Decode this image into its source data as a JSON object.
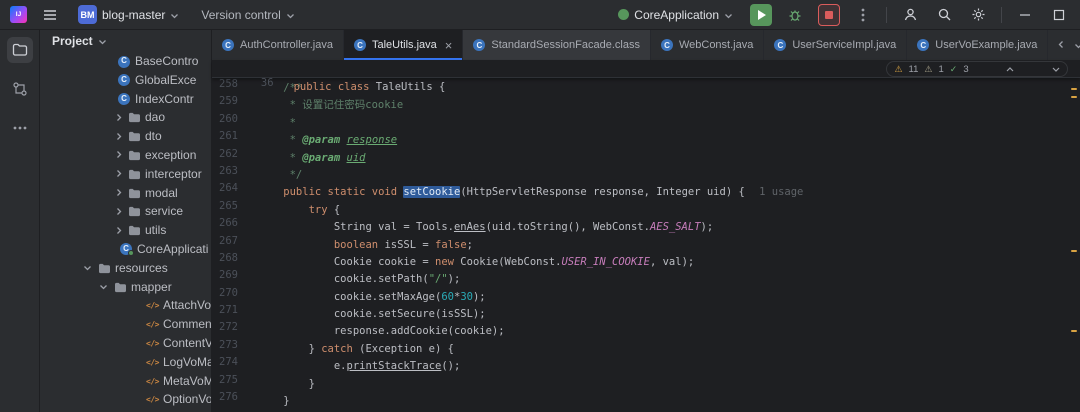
{
  "icons": {
    "logo_text": "IJ",
    "class_glyph": "C",
    "xml_glyph": "</>",
    "close_glyph": "×",
    "more_glyph": "⋯",
    "warn_glyph": "⚠",
    "ok_glyph": "✓"
  },
  "titlebar": {
    "project_badge": "BM",
    "project_name": "blog-master",
    "vcs_label": "Version control",
    "run_config_name": "CoreApplication"
  },
  "project_panel": {
    "title": "Project",
    "tree": [
      {
        "label": "BaseContro",
        "kind": "class",
        "iconX": 78
      },
      {
        "label": "GlobalExce",
        "kind": "class",
        "iconX": 78
      },
      {
        "label": "IndexContr",
        "kind": "class",
        "iconX": 78
      },
      {
        "label": "dao",
        "kind": "folder",
        "chev": "right",
        "chevX": 74,
        "iconX": 88
      },
      {
        "label": "dto",
        "kind": "folder",
        "chev": "right",
        "chevX": 74,
        "iconX": 88
      },
      {
        "label": "exception",
        "kind": "folder",
        "chev": "right",
        "chevX": 74,
        "iconX": 88
      },
      {
        "label": "interceptor",
        "kind": "folder",
        "chev": "right",
        "chevX": 74,
        "iconX": 88
      },
      {
        "label": "modal",
        "kind": "folder",
        "chev": "right",
        "chevX": 74,
        "iconX": 88
      },
      {
        "label": "service",
        "kind": "folder",
        "chev": "right",
        "chevX": 74,
        "iconX": 88
      },
      {
        "label": "utils",
        "kind": "folder",
        "chev": "right",
        "chevX": 74,
        "iconX": 88
      },
      {
        "label": "CoreApplicati",
        "kind": "boot",
        "iconX": 80
      },
      {
        "label": "resources",
        "kind": "folder",
        "chev": "down",
        "chevX": 42,
        "iconX": 58
      },
      {
        "label": "mapper",
        "kind": "folder",
        "chev": "down",
        "chevX": 58,
        "iconX": 74
      },
      {
        "label": "AttachVoMap",
        "kind": "xml",
        "iconX": 106
      },
      {
        "label": "CommentVoM",
        "kind": "xml",
        "iconX": 106
      },
      {
        "label": "ContentVoMa",
        "kind": "xml",
        "iconX": 106
      },
      {
        "label": "LogVoMappe",
        "kind": "xml",
        "iconX": 106
      },
      {
        "label": "MetaVoMapp",
        "kind": "xml",
        "iconX": 106
      },
      {
        "label": "OptionVoMap",
        "kind": "xml",
        "iconX": 106
      }
    ]
  },
  "tabs": {
    "items": [
      {
        "label": "AuthController.java",
        "icon": "class",
        "active": false
      },
      {
        "label": "TaleUtils.java",
        "icon": "class",
        "active": true
      },
      {
        "label": "StandardSessionFacade.class",
        "icon": "class",
        "active": false,
        "variant": "light"
      },
      {
        "label": "WebConst.java",
        "icon": "class",
        "active": false
      },
      {
        "label": "UserServiceImpl.java",
        "icon": "class",
        "active": false
      },
      {
        "label": "UserVoExample.java",
        "icon": "class",
        "active": false
      }
    ]
  },
  "editor": {
    "sticky_line": {
      "no": "36",
      "segments": [
        [
          "kw",
          "public class "
        ],
        [
          "plain",
          "TaleUtils {"
        ]
      ]
    },
    "inspections": {
      "warn": "11",
      "weak": "1",
      "ok": "3"
    },
    "lines": [
      {
        "no": "258",
        "segments": [
          [
            "doc",
            "    /**"
          ]
        ]
      },
      {
        "no": "259",
        "segments": [
          [
            "doc",
            "     * 设置记住密码cookie"
          ]
        ]
      },
      {
        "no": "260",
        "segments": [
          [
            "doc",
            "     *"
          ]
        ]
      },
      {
        "no": "261",
        "segments": [
          [
            "doc",
            "     * "
          ],
          [
            "doctag",
            "@param"
          ],
          [
            "doc",
            " "
          ],
          [
            "docparam",
            "response"
          ]
        ]
      },
      {
        "no": "262",
        "segments": [
          [
            "doc",
            "     * "
          ],
          [
            "doctag",
            "@param"
          ],
          [
            "doc",
            " "
          ],
          [
            "docparam",
            "uid"
          ]
        ]
      },
      {
        "no": "263",
        "segments": [
          [
            "doc",
            "     */"
          ]
        ]
      },
      {
        "no": "264",
        "segments": [
          [
            "kw",
            "    public static void "
          ],
          [
            "sel",
            "setCookie"
          ],
          [
            "plain",
            "(HttpServletResponse response, Integer uid) { "
          ],
          [
            "inlay",
            "1 usage"
          ]
        ]
      },
      {
        "no": "265",
        "segments": [
          [
            "plain",
            "        "
          ],
          [
            "kw",
            "try"
          ],
          [
            "plain",
            " {"
          ]
        ]
      },
      {
        "no": "266",
        "segments": [
          [
            "plain",
            "            String val = Tools."
          ],
          [
            "mcall",
            "enAes"
          ],
          [
            "plain",
            "(uid.toString(), WebConst."
          ],
          [
            "field",
            "AES_SALT"
          ],
          [
            "plain",
            ");"
          ]
        ]
      },
      {
        "no": "267",
        "segments": [
          [
            "plain",
            "            "
          ],
          [
            "kw",
            "boolean"
          ],
          [
            "plain",
            " isSSL = "
          ],
          [
            "kw",
            "false"
          ],
          [
            "plain",
            ";"
          ]
        ]
      },
      {
        "no": "268",
        "segments": [
          [
            "plain",
            "            Cookie cookie = "
          ],
          [
            "kw",
            "new"
          ],
          [
            "plain",
            " Cookie(WebConst."
          ],
          [
            "field",
            "USER_IN_COOKIE"
          ],
          [
            "plain",
            ", val);"
          ]
        ]
      },
      {
        "no": "269",
        "segments": [
          [
            "plain",
            "            cookie.setPath("
          ],
          [
            "str",
            "\"/\""
          ],
          [
            "plain",
            ");"
          ]
        ]
      },
      {
        "no": "270",
        "segments": [
          [
            "plain",
            "            cookie.setMaxAge("
          ],
          [
            "num",
            "60"
          ],
          [
            "plain",
            "*"
          ],
          [
            "num",
            "30"
          ],
          [
            "plain",
            ");"
          ]
        ]
      },
      {
        "no": "271",
        "segments": [
          [
            "plain",
            "            cookie.setSecure(isSSL);"
          ]
        ]
      },
      {
        "no": "272",
        "segments": [
          [
            "plain",
            "            response.addCookie(cookie);"
          ]
        ]
      },
      {
        "no": "273",
        "segments": [
          [
            "plain",
            "        } "
          ],
          [
            "kw",
            "catch"
          ],
          [
            "plain",
            " (Exception e) {"
          ]
        ]
      },
      {
        "no": "274",
        "segments": [
          [
            "plain",
            "            e."
          ],
          [
            "mcall",
            "printStackTrace"
          ],
          [
            "plain",
            "();"
          ]
        ]
      },
      {
        "no": "275",
        "segments": [
          [
            "plain",
            "        }"
          ]
        ]
      },
      {
        "no": "276",
        "segments": [
          [
            "plain",
            "    }"
          ]
        ]
      }
    ]
  }
}
